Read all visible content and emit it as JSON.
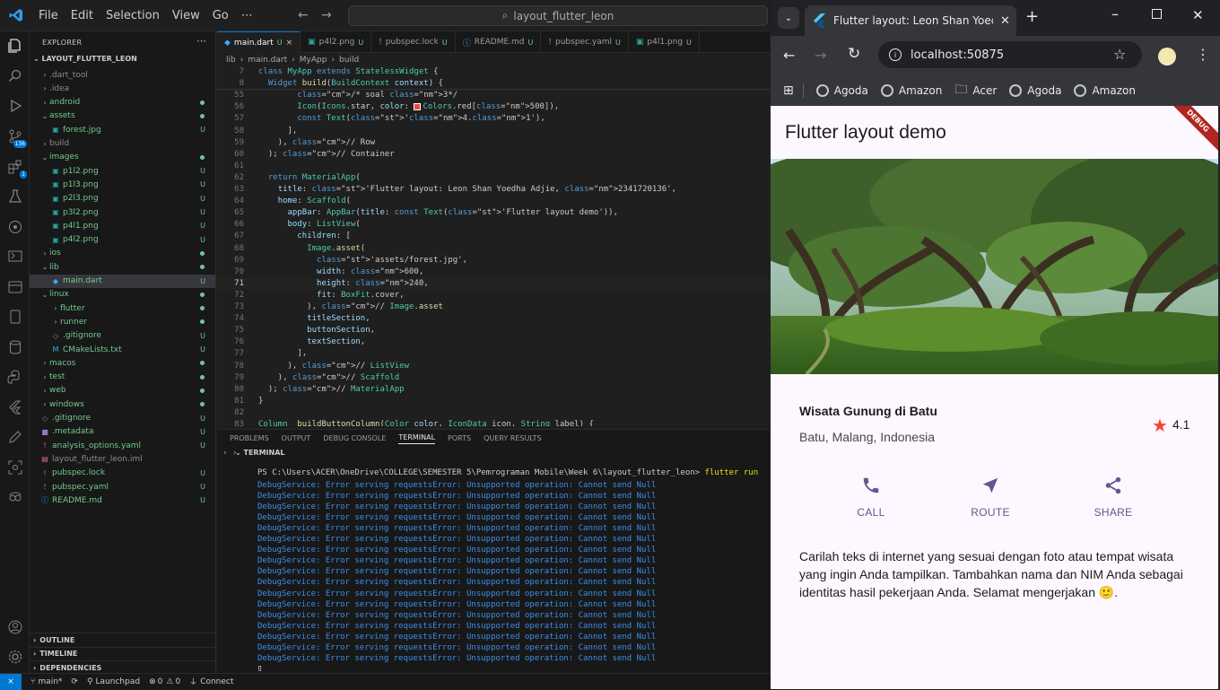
{
  "vscode": {
    "menu": [
      "File",
      "Edit",
      "Selection",
      "View",
      "Go",
      "⋯"
    ],
    "command_center": "layout_flutter_leon",
    "explorer_title": "EXPLORER",
    "root": "LAYOUT_FLUTTER_LEON",
    "tree": [
      {
        "label": ".dart_tool",
        "indent": 1,
        "type": "folder",
        "status": ""
      },
      {
        "label": ".idea",
        "indent": 1,
        "type": "folder",
        "status": ""
      },
      {
        "label": "android",
        "indent": 1,
        "type": "folder",
        "status": "dot"
      },
      {
        "label": "assets",
        "indent": 1,
        "type": "folder-open",
        "status": "dot"
      },
      {
        "label": "forest.jpg",
        "indent": 2,
        "type": "file",
        "status": "U"
      },
      {
        "label": "build",
        "indent": 1,
        "type": "folder",
        "status": ""
      },
      {
        "label": "images",
        "indent": 1,
        "type": "folder-open",
        "status": "dot"
      },
      {
        "label": "p1l2.png",
        "indent": 2,
        "type": "file",
        "status": "U"
      },
      {
        "label": "p1l3.png",
        "indent": 2,
        "type": "file",
        "status": "U"
      },
      {
        "label": "p2l3.png",
        "indent": 2,
        "type": "file",
        "status": "U"
      },
      {
        "label": "p3l2.png",
        "indent": 2,
        "type": "file",
        "status": "U"
      },
      {
        "label": "p4l1.png",
        "indent": 2,
        "type": "file",
        "status": "U"
      },
      {
        "label": "p4l2.png",
        "indent": 2,
        "type": "file",
        "status": "U"
      },
      {
        "label": "ios",
        "indent": 1,
        "type": "folder",
        "status": "dot"
      },
      {
        "label": "lib",
        "indent": 1,
        "type": "folder-open",
        "status": "dot"
      },
      {
        "label": "main.dart",
        "indent": 2,
        "type": "file",
        "status": "U",
        "selected": true
      },
      {
        "label": "linux",
        "indent": 1,
        "type": "folder-open",
        "status": "dot"
      },
      {
        "label": "flutter",
        "indent": 2,
        "type": "folder",
        "status": "dot"
      },
      {
        "label": "runner",
        "indent": 2,
        "type": "folder",
        "status": "dot"
      },
      {
        "label": ".gitignore",
        "indent": 2,
        "type": "file",
        "status": "U"
      },
      {
        "label": "CMakeLists.txt",
        "indent": 2,
        "type": "file",
        "status": "U"
      },
      {
        "label": "macos",
        "indent": 1,
        "type": "folder",
        "status": "dot"
      },
      {
        "label": "test",
        "indent": 1,
        "type": "folder",
        "status": "dot"
      },
      {
        "label": "web",
        "indent": 1,
        "type": "folder",
        "status": "dot"
      },
      {
        "label": "windows",
        "indent": 1,
        "type": "folder",
        "status": "dot"
      },
      {
        "label": ".gitignore",
        "indent": 1,
        "type": "file",
        "status": "U"
      },
      {
        "label": ".metadata",
        "indent": 1,
        "type": "file",
        "status": "U"
      },
      {
        "label": "analysis_options.yaml",
        "indent": 1,
        "type": "file",
        "status": "U"
      },
      {
        "label": "layout_flutter_leon.iml",
        "indent": 1,
        "type": "file",
        "status": ""
      },
      {
        "label": "pubspec.lock",
        "indent": 1,
        "type": "file",
        "status": "U"
      },
      {
        "label": "pubspec.yaml",
        "indent": 1,
        "type": "file",
        "status": "U"
      },
      {
        "label": "README.md",
        "indent": 1,
        "type": "file",
        "status": "U"
      }
    ],
    "outline_sections": [
      "OUTLINE",
      "TIMELINE",
      "DEPENDENCIES"
    ],
    "tabs": [
      {
        "label": "main.dart",
        "status": "U",
        "active": true
      },
      {
        "label": "p4l2.png",
        "status": "U"
      },
      {
        "label": "pubspec.lock",
        "status": "U"
      },
      {
        "label": "README.md",
        "status": "U"
      },
      {
        "label": "pubspec.yaml",
        "status": "U"
      },
      {
        "label": "p4l1.png",
        "status": "U"
      }
    ],
    "breadcrumbs": [
      "lib",
      "main.dart",
      "MyApp",
      "build"
    ],
    "sticky": [
      {
        "n": "7",
        "code": "class MyApp extends StatelessWidget {"
      },
      {
        "n": "8",
        "code": "  Widget build(BuildContext context) {"
      }
    ],
    "code": [
      {
        "n": "55",
        "code": "        /* soal 3*/"
      },
      {
        "n": "56",
        "code": "        Icon(Icons.star, color: Colors.red[500]),"
      },
      {
        "n": "57",
        "code": "        const Text('4.1'),"
      },
      {
        "n": "58",
        "code": "      ],"
      },
      {
        "n": "59",
        "code": "    ), // Row"
      },
      {
        "n": "60",
        "code": "  ); // Container"
      },
      {
        "n": "61",
        "code": ""
      },
      {
        "n": "62",
        "code": "  return MaterialApp("
      },
      {
        "n": "63",
        "code": "    title: 'Flutter layout: Leon Shan Yoedha Adjie, 2341720136',"
      },
      {
        "n": "64",
        "code": "    home: Scaffold("
      },
      {
        "n": "65",
        "code": "      appBar: AppBar(title: const Text('Flutter layout demo')),"
      },
      {
        "n": "66",
        "code": "      body: ListView("
      },
      {
        "n": "67",
        "code": "        children: ["
      },
      {
        "n": "68",
        "code": "          Image.asset("
      },
      {
        "n": "69",
        "code": "            'assets/forest.jpg',"
      },
      {
        "n": "70",
        "code": "            width: 600,"
      },
      {
        "n": "71",
        "code": "            height: 240,"
      },
      {
        "n": "72",
        "code": "            fit: BoxFit.cover,"
      },
      {
        "n": "73",
        "code": "          ), // Image.asset"
      },
      {
        "n": "74",
        "code": "          titleSection,"
      },
      {
        "n": "75",
        "code": "          buttonSection,"
      },
      {
        "n": "76",
        "code": "          textSection,"
      },
      {
        "n": "77",
        "code": "        ],"
      },
      {
        "n": "78",
        "code": "      ), // ListView"
      },
      {
        "n": "79",
        "code": "    ), // Scaffold"
      },
      {
        "n": "80",
        "code": "  ); // MaterialApp"
      },
      {
        "n": "81",
        "code": "}"
      },
      {
        "n": "82",
        "code": ""
      },
      {
        "n": "83",
        "code": "Column _buildButtonColumn(Color color, IconData icon, String label) {"
      }
    ],
    "panel_tabs": [
      "PROBLEMS",
      "OUTPUT",
      "DEBUG CONSOLE",
      "TERMINAL",
      "PORTS",
      "QUERY RESULTS"
    ],
    "terminal_title": "TERMINAL",
    "terminal_prompt": "PS C:\\Users\\ACER\\OneDrive\\COLLEGE\\SEMESTER 5\\Pemrograman Mobile\\Week 6\\layout_flutter_leon>",
    "terminal_cmd": "flutter run",
    "terminal_error": "DebugService: Error serving requestsError: Unsupported operation: Cannot send Null",
    "terminal_error_count": 17,
    "status": {
      "branch": "main*",
      "launchpad": "Launchpad",
      "errors": "0",
      "warnings": "0",
      "connect": "Connect"
    },
    "scm_badge": "136",
    "ext_badge": "1"
  },
  "browser": {
    "tab_title": "Flutter layout: Leon Shan Yoedha Adjie",
    "url": "localhost:50875",
    "bookmarks": [
      {
        "label": "Agoda",
        "icon": "globe"
      },
      {
        "label": "Amazon",
        "icon": "globe"
      },
      {
        "label": "Acer",
        "icon": "folder"
      },
      {
        "label": "Agoda",
        "icon": "globe"
      },
      {
        "label": "Amazon",
        "icon": "globe"
      }
    ]
  },
  "app": {
    "appbar_title": "Flutter layout demo",
    "debug_banner": "DEBUG",
    "title": "Wisata Gunung di Batu",
    "subtitle": "Batu, Malang, Indonesia",
    "rating": "4.1",
    "buttons": [
      {
        "label": "CALL",
        "icon": "phone-icon"
      },
      {
        "label": "ROUTE",
        "icon": "navigation-icon"
      },
      {
        "label": "SHARE",
        "icon": "share-icon"
      }
    ],
    "description": "Carilah teks di internet yang sesuai dengan foto atau tempat wisata yang ingin Anda tampilkan. Tambahkan nama dan NIM Anda sebagai identitas hasil pekerjaan Anda. Selamat mengerjakan 🙂.",
    "colors": {
      "accent": "#65558f",
      "star": "#f44336",
      "background": "#fdf7ff"
    }
  }
}
